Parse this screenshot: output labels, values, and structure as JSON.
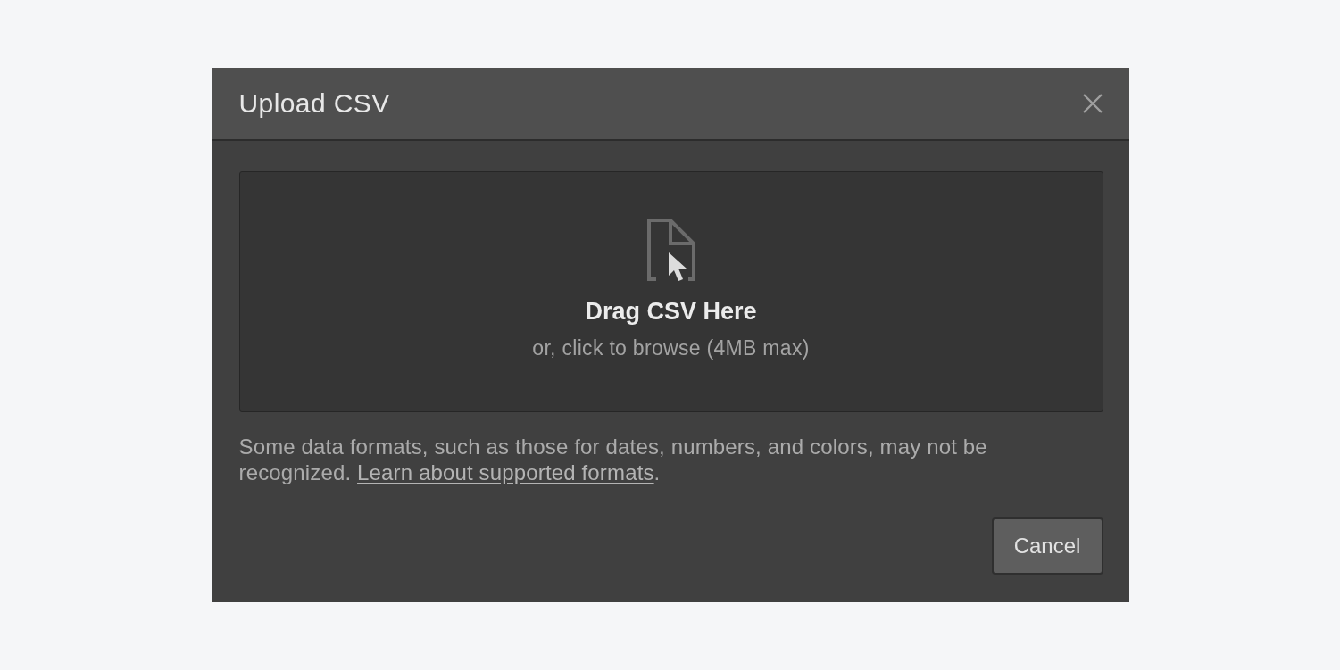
{
  "dialog": {
    "title": "Upload CSV"
  },
  "dropzone": {
    "title": "Drag CSV Here",
    "subtitle": "or, click to browse (4MB max)"
  },
  "note": {
    "text": "Some data formats, such as those for dates, numbers, and colors, may not be recognized. ",
    "link": "Learn about supported formats",
    "after": "."
  },
  "buttons": [
    {
      "label": "Cancel"
    }
  ]
}
